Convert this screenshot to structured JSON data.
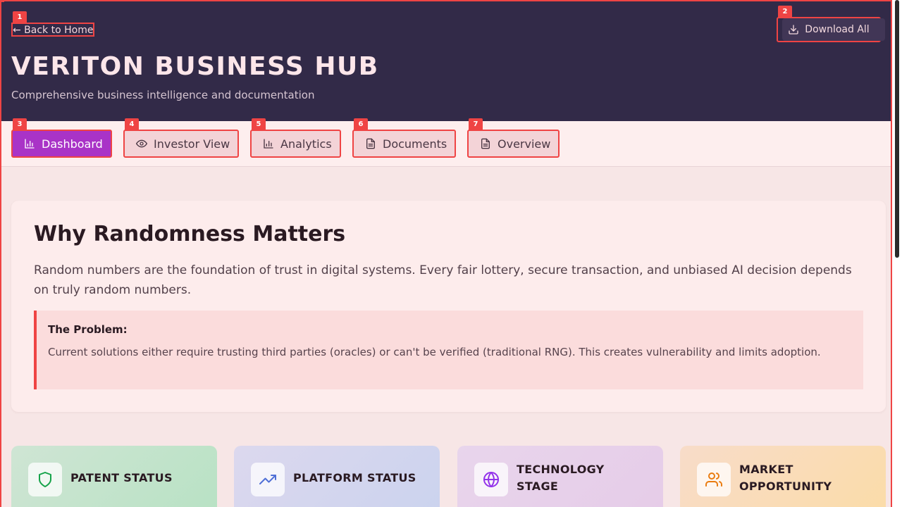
{
  "header": {
    "back_link": "← Back to Home",
    "download_label": "Download All",
    "title": "VERITON BUSINESS HUB",
    "subtitle": "Comprehensive business intelligence and documentation"
  },
  "tabs": [
    {
      "label": "Dashboard",
      "icon": "bar-chart-icon",
      "active": true
    },
    {
      "label": "Investor View",
      "icon": "eye-icon",
      "active": false
    },
    {
      "label": "Analytics",
      "icon": "bar-chart-icon",
      "active": false
    },
    {
      "label": "Documents",
      "icon": "document-icon",
      "active": false
    },
    {
      "label": "Overview",
      "icon": "document-icon",
      "active": false
    }
  ],
  "badges": [
    "1",
    "2",
    "3",
    "4",
    "5",
    "6",
    "7"
  ],
  "section": {
    "title": "Why Randomness Matters",
    "lead": "Random numbers are the foundation of trust in digital systems. Every fair lottery, secure transaction, and unbiased AI decision depends on truly random numbers.",
    "problem_title": "The Problem:",
    "problem_body": "Current solutions either require trusting third parties (oracles) or can't be verified (traditional RNG). This creates vulnerability and limits adoption."
  },
  "stats": [
    {
      "label": "PATENT STATUS",
      "icon": "shield-icon",
      "color": "#16a34a"
    },
    {
      "label": "PLATFORM STATUS",
      "icon": "trending-up-icon",
      "color": "#4f6fd6"
    },
    {
      "label": "TECHNOLOGY STAGE",
      "icon": "globe-icon",
      "color": "#9333ea"
    },
    {
      "label": "MARKET OPPORTUNITY",
      "icon": "users-icon",
      "color": "#ea7c10"
    }
  ],
  "colors": {
    "header_bg": "#322a48",
    "accent": "#a933c7",
    "annotation": "#ef4444"
  }
}
